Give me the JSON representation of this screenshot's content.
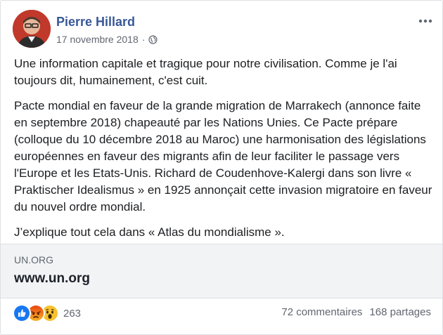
{
  "post": {
    "author": "Pierre Hillard",
    "date": "17 novembre 2018",
    "separator": "·",
    "privacy_icon": "globe-icon",
    "more_icon": "ellipsis-icon",
    "paragraphs": [
      "Une information capitale et tragique pour notre civilisation. Comme je l'ai toujours dit, humainement, c'est cuit.",
      "Pacte mondial en faveur de la grande migration de Marrakech (annonce faite en septembre 2018) chapeauté par les Nations Unies. Ce Pacte prépare (colloque du 10 décembre 2018 au Maroc) une harmonisation des législations européennes en faveur des migrants afin de leur faciliter le passage vers l'Europe et les Etats-Unis. Richard de Coudenhove-Kalergi dans son livre « Praktischer Idealismus » en 1925 annonçait cette invasion migratoire en faveur du nouvel ordre mondial.",
      "J’explique tout cela dans « Atlas du mondialisme »."
    ]
  },
  "link": {
    "domain": "UN.ORG",
    "title": "www.un.org"
  },
  "footer": {
    "reaction_icons": [
      "like-icon",
      "angry-icon",
      "wow-icon"
    ],
    "reaction_count": "263",
    "comments": "72 commentaires",
    "shares": "168 partages"
  },
  "colors": {
    "author": "#385898",
    "like": "#1877f2",
    "angry": "#e9710f",
    "wow": "#f7b125",
    "card_bg": "#f2f3f5"
  }
}
